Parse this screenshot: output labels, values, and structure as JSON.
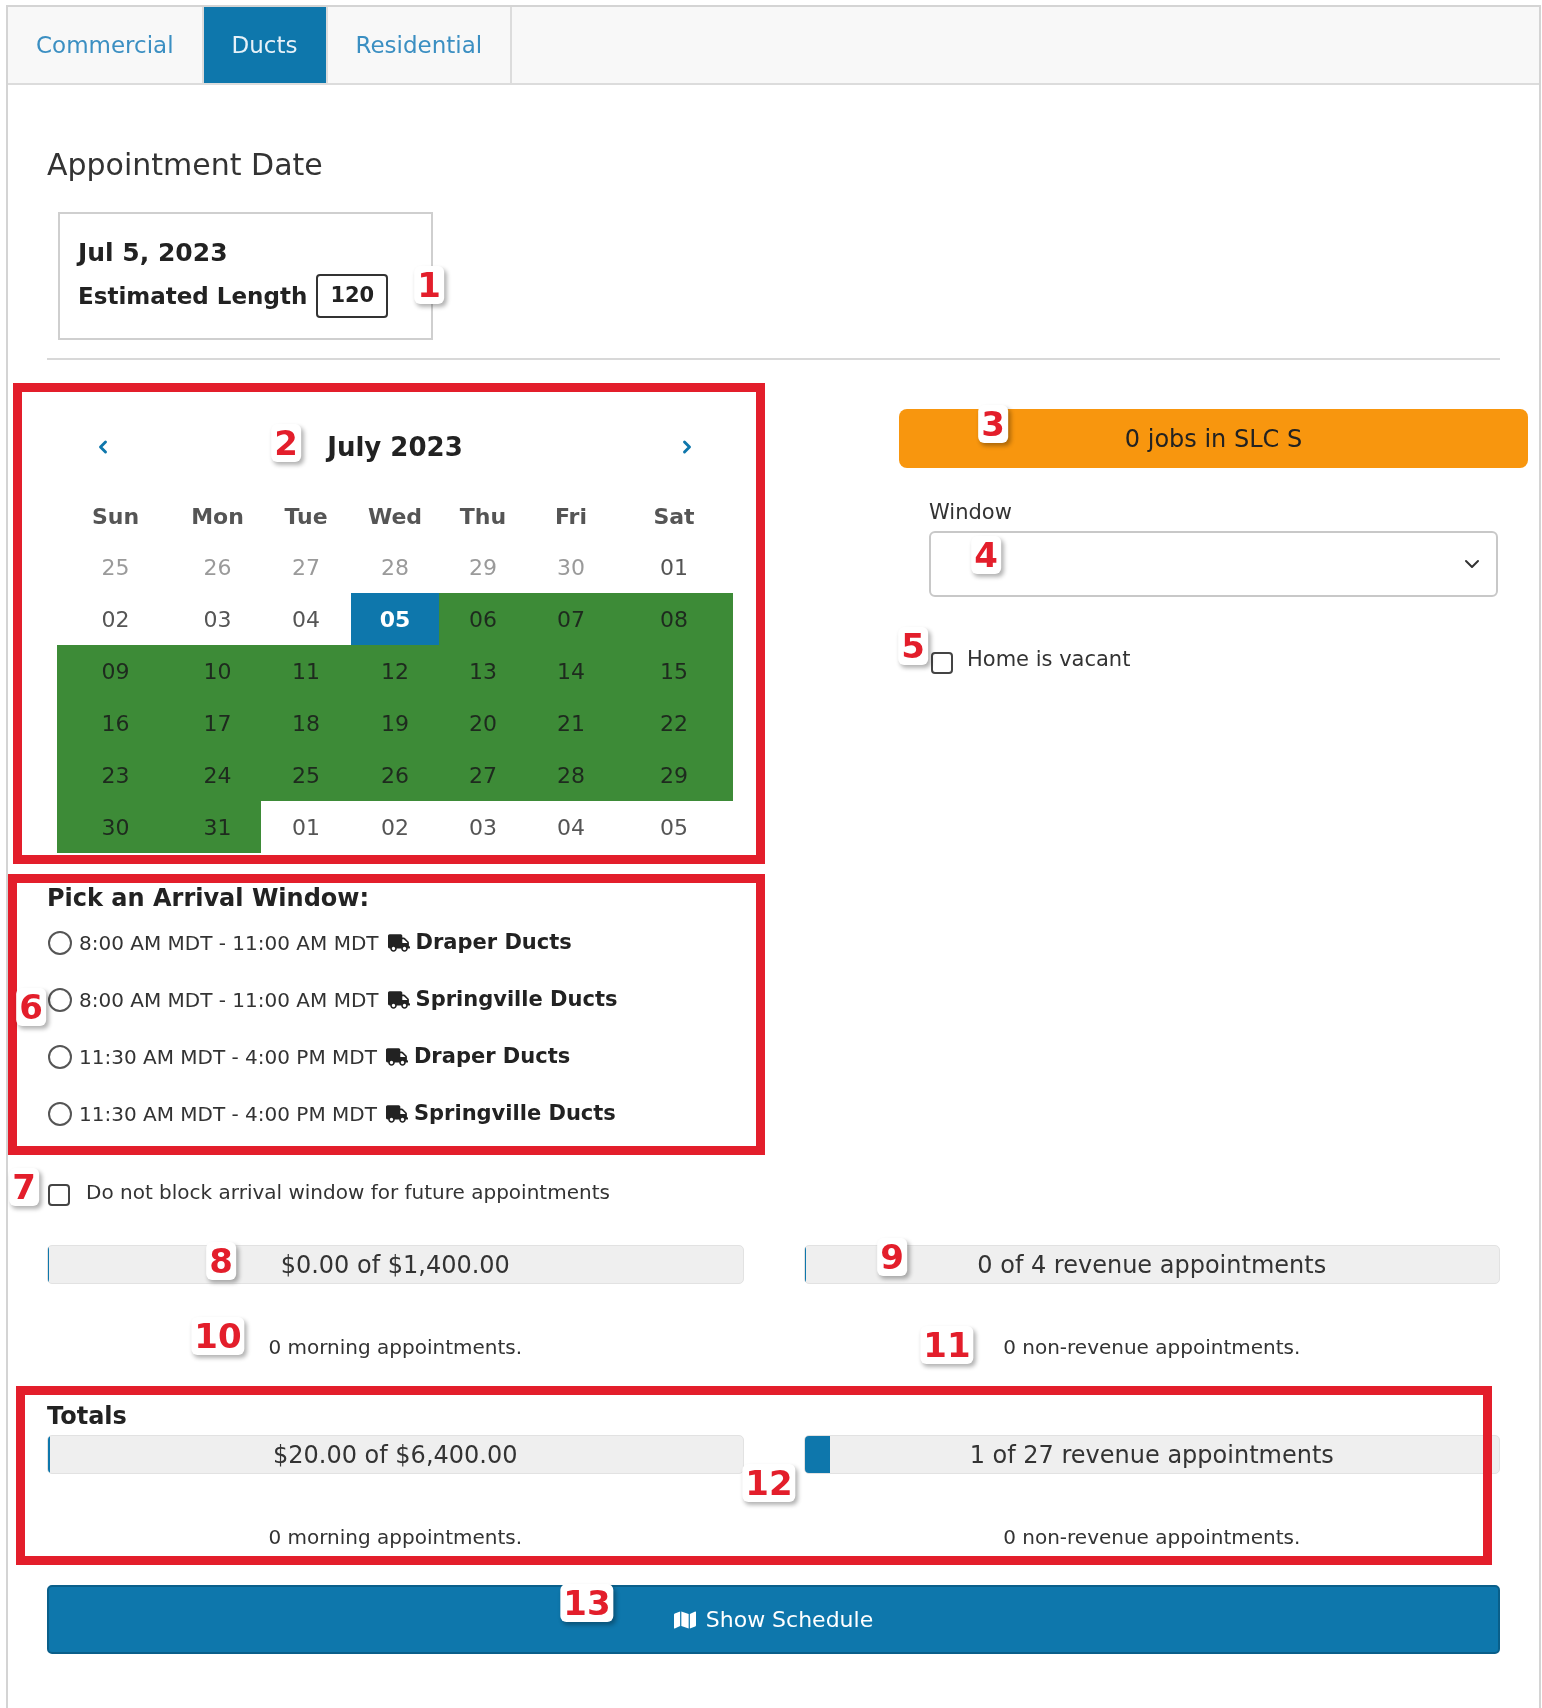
{
  "tabs": [
    {
      "label": "Commercial",
      "selected": false
    },
    {
      "label": "Ducts",
      "selected": true
    },
    {
      "label": "Residential",
      "selected": false
    }
  ],
  "appointment_date": {
    "heading": "Appointment Date",
    "date": "Jul 5, 2023",
    "estimated_length_label": "Estimated Length",
    "estimated_length_value": "120"
  },
  "calendar": {
    "month": "July 2023",
    "weekdays": [
      "Sun",
      "Mon",
      "Tue",
      "Wed",
      "Thu",
      "Fri",
      "Sat"
    ],
    "weeks": [
      [
        {
          "day": "25",
          "muted": true,
          "available": false,
          "selected": false
        },
        {
          "day": "26",
          "muted": true,
          "available": false,
          "selected": false
        },
        {
          "day": "27",
          "muted": true,
          "available": false,
          "selected": false
        },
        {
          "day": "28",
          "muted": true,
          "available": false,
          "selected": false
        },
        {
          "day": "29",
          "muted": true,
          "available": false,
          "selected": false
        },
        {
          "day": "30",
          "muted": true,
          "available": false,
          "selected": false
        },
        {
          "day": "01",
          "muted": false,
          "available": false,
          "selected": false
        }
      ],
      [
        {
          "day": "02",
          "muted": false,
          "available": false,
          "selected": false
        },
        {
          "day": "03",
          "muted": false,
          "available": false,
          "selected": false
        },
        {
          "day": "04",
          "muted": false,
          "available": false,
          "selected": false
        },
        {
          "day": "05",
          "muted": false,
          "available": false,
          "selected": true
        },
        {
          "day": "06",
          "muted": false,
          "available": true,
          "selected": false
        },
        {
          "day": "07",
          "muted": false,
          "available": true,
          "selected": false
        },
        {
          "day": "08",
          "muted": false,
          "available": true,
          "selected": false
        }
      ],
      [
        {
          "day": "09",
          "muted": false,
          "available": true,
          "selected": false
        },
        {
          "day": "10",
          "muted": false,
          "available": true,
          "selected": false
        },
        {
          "day": "11",
          "muted": false,
          "available": true,
          "selected": false
        },
        {
          "day": "12",
          "muted": false,
          "available": true,
          "selected": false
        },
        {
          "day": "13",
          "muted": false,
          "available": true,
          "selected": false
        },
        {
          "day": "14",
          "muted": false,
          "available": true,
          "selected": false
        },
        {
          "day": "15",
          "muted": false,
          "available": true,
          "selected": false
        }
      ],
      [
        {
          "day": "16",
          "muted": false,
          "available": true,
          "selected": false
        },
        {
          "day": "17",
          "muted": false,
          "available": true,
          "selected": false
        },
        {
          "day": "18",
          "muted": false,
          "available": true,
          "selected": false
        },
        {
          "day": "19",
          "muted": false,
          "available": true,
          "selected": false
        },
        {
          "day": "20",
          "muted": false,
          "available": true,
          "selected": false
        },
        {
          "day": "21",
          "muted": false,
          "available": true,
          "selected": false
        },
        {
          "day": "22",
          "muted": false,
          "available": true,
          "selected": false
        }
      ],
      [
        {
          "day": "23",
          "muted": false,
          "available": true,
          "selected": false
        },
        {
          "day": "24",
          "muted": false,
          "available": true,
          "selected": false
        },
        {
          "day": "25",
          "muted": false,
          "available": true,
          "selected": false
        },
        {
          "day": "26",
          "muted": false,
          "available": true,
          "selected": false
        },
        {
          "day": "27",
          "muted": false,
          "available": true,
          "selected": false
        },
        {
          "day": "28",
          "muted": false,
          "available": true,
          "selected": false
        },
        {
          "day": "29",
          "muted": false,
          "available": true,
          "selected": false
        }
      ],
      [
        {
          "day": "30",
          "muted": false,
          "available": true,
          "selected": false
        },
        {
          "day": "31",
          "muted": false,
          "available": true,
          "selected": false
        },
        {
          "day": "01",
          "muted": false,
          "available": false,
          "selected": false
        },
        {
          "day": "02",
          "muted": false,
          "available": false,
          "selected": false
        },
        {
          "day": "03",
          "muted": false,
          "available": false,
          "selected": false
        },
        {
          "day": "04",
          "muted": false,
          "available": false,
          "selected": false
        },
        {
          "day": "05",
          "muted": false,
          "available": false,
          "selected": false
        }
      ]
    ]
  },
  "jobs_banner": {
    "text": "0 jobs in SLC S"
  },
  "window_select": {
    "label": "Window"
  },
  "home_vacant": {
    "label": "Home is vacant",
    "checked": false
  },
  "arrival_windows": {
    "heading": "Pick an Arrival Window:",
    "options": [
      {
        "time": "8:00 AM MDT - 11:00 AM MDT",
        "crew": "Draper Ducts",
        "selected": false
      },
      {
        "time": "8:00 AM MDT - 11:00 AM MDT",
        "crew": "Springville Ducts",
        "selected": false
      },
      {
        "time": "11:30 AM MDT - 4:00 PM MDT",
        "crew": "Draper Ducts",
        "selected": false
      },
      {
        "time": "11:30 AM MDT - 4:00 PM MDT",
        "crew": "Springville Ducts",
        "selected": false
      }
    ]
  },
  "do_not_block": {
    "label": "Do not block arrival window for future appointments",
    "checked": false
  },
  "day_stats": {
    "revenue": {
      "text": "$0.00 of $1,400.00",
      "level": 0
    },
    "appointments": {
      "text": "0 of 4 revenue appointments",
      "level": 0
    },
    "morning": "0 morning appointments.",
    "non_revenue": "0 non-revenue appointments."
  },
  "totals": {
    "heading": "Totals",
    "revenue": {
      "text": "$20.00 of $6,400.00",
      "level": 0.003
    },
    "appointments": {
      "text": "1 of 27 revenue appointments",
      "level": 0.037
    },
    "morning": "0 morning appointments.",
    "non_revenue": "0 non-revenue appointments."
  },
  "show_schedule_button": {
    "label": "Show Schedule"
  },
  "annotations": [
    {
      "label": "1",
      "boxed": false
    },
    {
      "label": "2",
      "boxed": true
    },
    {
      "label": "3",
      "boxed": false
    },
    {
      "label": "4",
      "boxed": false
    },
    {
      "label": "5",
      "boxed": false
    },
    {
      "label": "6",
      "boxed": true
    },
    {
      "label": "7",
      "boxed": false
    },
    {
      "label": "8",
      "boxed": false
    },
    {
      "label": "9",
      "boxed": false
    },
    {
      "label": "10",
      "boxed": false
    },
    {
      "label": "11",
      "boxed": false
    },
    {
      "label": "12",
      "boxed": true
    },
    {
      "label": "13",
      "boxed": false
    }
  ]
}
